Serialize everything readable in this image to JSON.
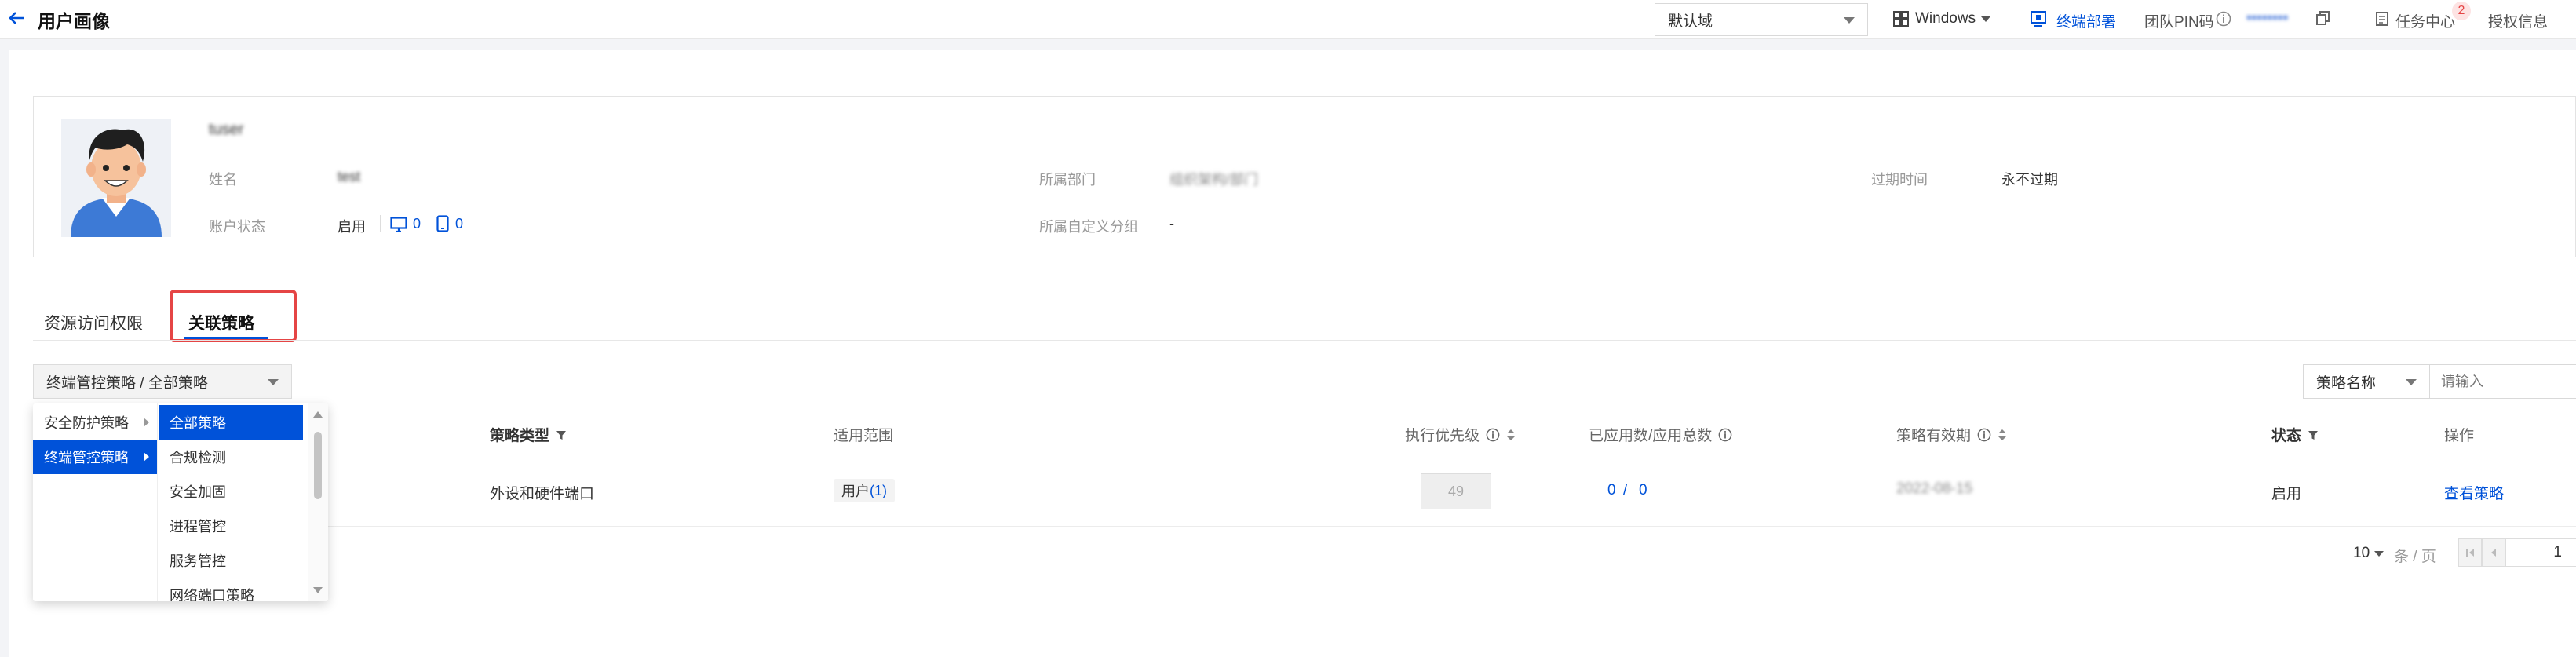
{
  "header": {
    "title": "用户画像",
    "domain_select": "默认域",
    "os_select": "Windows",
    "deploy_label": "终端部署",
    "team_pin_label": "团队PIN码",
    "team_pin_value": "••••••••",
    "task_center_label": "任务中心",
    "task_center_badge": "2",
    "license_label": "授权信息"
  },
  "user": {
    "display_name": "tuser",
    "fields": {
      "name_label": "姓名",
      "name_value": "test",
      "status_label": "账户状态",
      "status_value": "启用",
      "pc_count": "0",
      "mobile_count": "0",
      "dept_label": "所属部门",
      "dept_value": "组织架构/部门",
      "group_label": "所属自定义分组",
      "group_value": "-",
      "expire_label": "过期时间",
      "expire_value": "永不过期"
    }
  },
  "tabs": [
    {
      "label": "资源访问权限",
      "active": false
    },
    {
      "label": "关联策略",
      "active": true
    }
  ],
  "filters": {
    "cascader_value": "终端管控策略 / 全部策略",
    "search_field": "策略名称",
    "search_placeholder": "请输入"
  },
  "cascader": {
    "level1": [
      {
        "label": "安全防护策略",
        "selected": false
      },
      {
        "label": "终端管控策略",
        "selected": true
      }
    ],
    "level2": [
      {
        "label": "全部策略",
        "selected": true
      },
      {
        "label": "合规检测",
        "selected": false
      },
      {
        "label": "安全加固",
        "selected": false
      },
      {
        "label": "进程管控",
        "selected": false
      },
      {
        "label": "服务管控",
        "selected": false
      },
      {
        "label": "网络端口策略",
        "selected": false
      }
    ]
  },
  "table": {
    "headers": {
      "type": "策略类型",
      "scope": "适用范围",
      "priority": "执行优先级",
      "applied": "已应用数/应用总数",
      "validity": "策略有效期",
      "status": "状态",
      "actions": "操作"
    },
    "rows": [
      {
        "type": "外设和硬件端口",
        "scope_label": "用户",
        "scope_count": "(1)",
        "priority": "49",
        "applied": "0",
        "total": "0",
        "separator": "/",
        "validity": "2022-08-15",
        "status": "启用",
        "action": "查看策略"
      }
    ]
  },
  "pagination": {
    "page_size": "10",
    "per_page_label": "条 / 页",
    "current_page": "1"
  },
  "colors": {
    "accent": "#0052d9",
    "highlight_border": "#e54545",
    "badge": "#e54545"
  }
}
